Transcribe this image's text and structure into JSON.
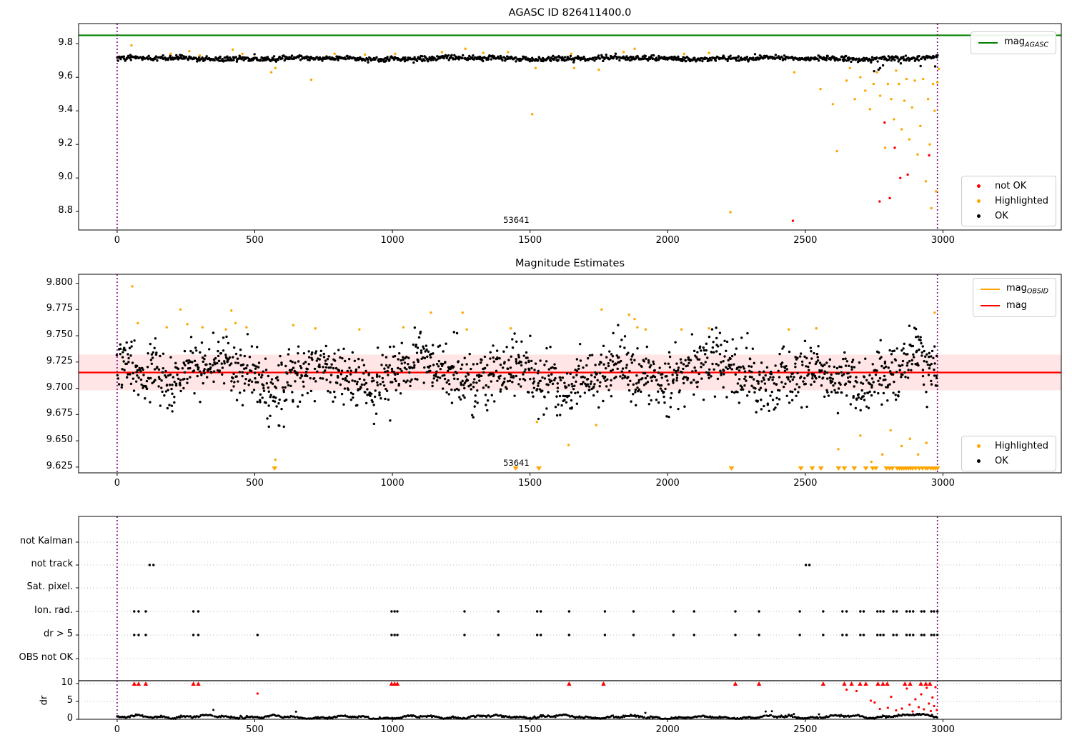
{
  "figure": {
    "title": "AGASC ID 826411400.0",
    "obsid_label": "53641"
  },
  "colors": {
    "green": "#008000",
    "orange": "#FFA500",
    "red": "#FF0000",
    "black": "#000000",
    "purple": "#800080",
    "band": "rgba(255,0,0,0.10)",
    "grid": "#bbbbbb",
    "frame": "#000000"
  },
  "legends": {
    "p1_line": {
      "prefix": "mag",
      "sub": "AGASC"
    },
    "p1_markers": [
      {
        "label": "not OK",
        "color": "#FF0000"
      },
      {
        "label": "Highlighted",
        "color": "#FFA500"
      },
      {
        "label": "OK",
        "color": "#000000"
      }
    ],
    "p2_lines": [
      {
        "prefix": "mag",
        "sub": "OBSID",
        "color": "#FFA500"
      },
      {
        "prefix": "mag",
        "sub": "",
        "color": "#FF0000"
      }
    ],
    "p2_markers": [
      {
        "label": "Highlighted",
        "color": "#FFA500"
      },
      {
        "label": "OK",
        "color": "#000000"
      }
    ]
  },
  "chart_data": [
    {
      "type": "scatter",
      "title": "AGASC ID 826411400.0",
      "xlim": [
        -140,
        3430
      ],
      "ylim": [
        8.69,
        9.92
      ],
      "x_ticks": [
        0,
        500,
        1000,
        1500,
        2000,
        2500,
        3000
      ],
      "y_tick_vals": [
        9.8,
        9.6,
        9.4,
        9.2,
        9.0,
        8.8
      ],
      "y_tick_labels": [
        "9.8",
        "9.6",
        "9.4",
        "9.2",
        "9.0",
        "8.8"
      ],
      "vlines": [
        0,
        2980
      ],
      "hline": {
        "name": "mag_AGASC",
        "y": 9.85
      },
      "annotation": {
        "text": "53641",
        "x": 1450
      },
      "ok_series": {
        "n": 1150,
        "x_range": [
          0,
          2980
        ],
        "mean": 9.712,
        "std": 0.0075
      },
      "highlighted": [
        [
          52,
          9.79
        ],
        [
          195,
          9.74
        ],
        [
          262,
          9.755
        ],
        [
          300,
          9.73
        ],
        [
          420,
          9.765
        ],
        [
          455,
          9.74
        ],
        [
          560,
          9.63
        ],
        [
          575,
          9.655
        ],
        [
          705,
          9.585
        ],
        [
          790,
          9.74
        ],
        [
          900,
          9.735
        ],
        [
          1010,
          9.74
        ],
        [
          1180,
          9.75
        ],
        [
          1265,
          9.77
        ],
        [
          1330,
          9.745
        ],
        [
          1420,
          9.75
        ],
        [
          1508,
          9.38
        ],
        [
          1520,
          9.655
        ],
        [
          1650,
          9.74
        ],
        [
          1660,
          9.655
        ],
        [
          1750,
          9.645
        ],
        [
          1840,
          9.75
        ],
        [
          1880,
          9.77
        ],
        [
          2060,
          9.74
        ],
        [
          2150,
          9.745
        ],
        [
          2228,
          8.796
        ],
        [
          2460,
          9.63
        ],
        [
          2555,
          9.53
        ],
        [
          2600,
          9.44
        ],
        [
          2615,
          9.16
        ],
        [
          2650,
          9.58
        ],
        [
          2662,
          9.655
        ],
        [
          2680,
          9.47
        ],
        [
          2700,
          9.6
        ],
        [
          2718,
          9.52
        ],
        [
          2735,
          9.41
        ],
        [
          2748,
          9.56
        ],
        [
          2760,
          9.63
        ],
        [
          2772,
          9.49
        ],
        [
          2790,
          9.18
        ],
        [
          2800,
          9.56
        ],
        [
          2812,
          9.47
        ],
        [
          2822,
          9.35
        ],
        [
          2830,
          9.64
        ],
        [
          2840,
          9.56
        ],
        [
          2850,
          9.29
        ],
        [
          2860,
          9.46
        ],
        [
          2868,
          9.59
        ],
        [
          2878,
          9.23
        ],
        [
          2888,
          9.42
        ],
        [
          2898,
          9.58
        ],
        [
          2908,
          9.14
        ],
        [
          2918,
          9.31
        ],
        [
          2928,
          9.59
        ],
        [
          2938,
          8.98
        ],
        [
          2946,
          9.47
        ],
        [
          2952,
          9.2
        ],
        [
          2958,
          8.82
        ],
        [
          2964,
          9.56
        ],
        [
          2970,
          9.4
        ],
        [
          2975,
          8.92
        ],
        [
          2980,
          9.57
        ],
        [
          2985,
          9.65
        ]
      ],
      "not_ok": [
        [
          2455,
          8.745
        ],
        [
          2770,
          8.86
        ],
        [
          2807,
          8.88
        ],
        [
          2845,
          9.0
        ],
        [
          2872,
          9.02
        ],
        [
          2950,
          9.135
        ],
        [
          2788,
          9.33
        ],
        [
          2825,
          9.18
        ]
      ]
    },
    {
      "type": "scatter",
      "title": "Magnitude Estimates",
      "xlim": [
        -140,
        3430
      ],
      "ylim": [
        9.6195,
        9.8085
      ],
      "x_ticks": [
        0,
        500,
        1000,
        1500,
        2000,
        2500,
        3000
      ],
      "y_tick_vals": [
        9.8,
        9.775,
        9.75,
        9.725,
        9.7,
        9.675,
        9.65,
        9.625
      ],
      "y_tick_labels": [
        "9.800",
        "9.775",
        "9.750",
        "9.725",
        "9.700",
        "9.675",
        "9.650",
        "9.625"
      ],
      "vlines": [
        0,
        2980
      ],
      "mag_line": {
        "y": 9.715,
        "band": [
          9.698,
          9.732
        ]
      },
      "annotation": {
        "text": "53641",
        "x": 1450
      },
      "ok_series": {
        "n": 1700,
        "x_range": [
          0,
          2980
        ],
        "mean": 9.7135,
        "std": 0.0135
      },
      "highlighted": [
        [
          55,
          9.797
        ],
        [
          75,
          9.762
        ],
        [
          180,
          9.758
        ],
        [
          230,
          9.775
        ],
        [
          255,
          9.761
        ],
        [
          310,
          9.758
        ],
        [
          395,
          9.756
        ],
        [
          415,
          9.774
        ],
        [
          430,
          9.762
        ],
        [
          470,
          9.758
        ],
        [
          575,
          9.632
        ],
        [
          640,
          9.76
        ],
        [
          720,
          9.757
        ],
        [
          880,
          9.756
        ],
        [
          1040,
          9.758
        ],
        [
          1140,
          9.772
        ],
        [
          1255,
          9.772
        ],
        [
          1270,
          9.756
        ],
        [
          1430,
          9.757
        ],
        [
          1525,
          9.668
        ],
        [
          1640,
          9.646
        ],
        [
          1740,
          9.665
        ],
        [
          1760,
          9.775
        ],
        [
          1860,
          9.77
        ],
        [
          1880,
          9.766
        ],
        [
          1890,
          9.758
        ],
        [
          1920,
          9.756
        ],
        [
          2050,
          9.756
        ],
        [
          2150,
          9.757
        ],
        [
          2440,
          9.756
        ],
        [
          2540,
          9.757
        ],
        [
          2620,
          9.642
        ],
        [
          2700,
          9.655
        ],
        [
          2740,
          9.63
        ],
        [
          2780,
          9.637
        ],
        [
          2810,
          9.66
        ],
        [
          2850,
          9.645
        ],
        [
          2880,
          9.652
        ],
        [
          2910,
          9.637
        ],
        [
          2940,
          9.648
        ],
        [
          2970,
          9.772
        ]
      ],
      "clipped_low_x": [
        572,
        1448,
        1532,
        2232,
        2484,
        2525,
        2557,
        2621,
        2642,
        2678,
        2720,
        2745,
        2756,
        2795,
        2806,
        2816,
        2834,
        2842,
        2850,
        2858,
        2866,
        2874,
        2882,
        2890,
        2901,
        2914,
        2926,
        2938,
        2945,
        2956,
        2964,
        2972,
        2980
      ]
    },
    {
      "type": "timeline-flags",
      "categories": [
        "not Kalman",
        "not track",
        "Sat. pixel.",
        "Ion. rad.",
        "dr > 5",
        "OBS not OK"
      ],
      "dr_axis_label": "dr",
      "dr_tick_vals": [
        10,
        5,
        0
      ],
      "dr_tick_labels": [
        "10",
        "5",
        "0"
      ],
      "x_ticks": [
        0,
        500,
        1000,
        1500,
        2000,
        2500,
        3000
      ],
      "vlines": [
        0,
        2980
      ],
      "hline_dr": 10.8,
      "not_track_x": [
        118,
        132,
        2502,
        2515
      ],
      "ion_rad_x": [
        62,
        78,
        104,
        277,
        295,
        997,
        1008,
        1018,
        1262,
        1385,
        1526,
        1539,
        1642,
        1772,
        1876,
        2021,
        2096,
        2246,
        2332,
        2480,
        2565,
        2635,
        2650,
        2700,
        2712,
        2762,
        2773,
        2784,
        2820,
        2832,
        2868,
        2880,
        2892,
        2922,
        2932,
        2958,
        2968,
        2980
      ],
      "dr5_x": [
        62,
        78,
        104,
        277,
        295,
        510,
        997,
        1008,
        1018,
        1262,
        1385,
        1526,
        1539,
        1642,
        1772,
        1876,
        2021,
        2096,
        2246,
        2332,
        2480,
        2565,
        2635,
        2650,
        2700,
        2712,
        2762,
        2773,
        2784,
        2820,
        2832,
        2868,
        2880,
        2892,
        2922,
        2932,
        2958,
        2968,
        2980
      ],
      "dr_red_clamped_x": [
        62,
        78,
        104,
        277,
        295,
        997,
        1008,
        1018,
        1642,
        1767,
        2246,
        2332,
        2565,
        2642,
        2668,
        2699,
        2720,
        2764,
        2782,
        2798,
        2862,
        2881,
        2920,
        2938,
        2953
      ],
      "dr_red_points": [
        [
          510,
          7.2
        ],
        [
          2650,
          8.3
        ],
        [
          2686,
          7.9
        ],
        [
          2738,
          5.2
        ],
        [
          2752,
          4.7
        ],
        [
          2771,
          2.9
        ],
        [
          2800,
          3.2
        ],
        [
          2812,
          6.3
        ],
        [
          2830,
          2.5
        ],
        [
          2851,
          3.0
        ],
        [
          2869,
          8.6
        ],
        [
          2879,
          4.1
        ],
        [
          2890,
          2.2
        ],
        [
          2900,
          5.6
        ],
        [
          2912,
          3.4
        ],
        [
          2921,
          7.0
        ],
        [
          2931,
          2.8
        ],
        [
          2941,
          8.8
        ],
        [
          2949,
          4.4
        ],
        [
          2956,
          2.3
        ],
        [
          2962,
          6.1
        ],
        [
          2968,
          3.7
        ],
        [
          2973,
          9.0
        ],
        [
          2978,
          2.6
        ]
      ],
      "dr_line": {
        "x_range": [
          0,
          2980
        ],
        "typical": 0.8,
        "max": 2.5
      }
    }
  ]
}
